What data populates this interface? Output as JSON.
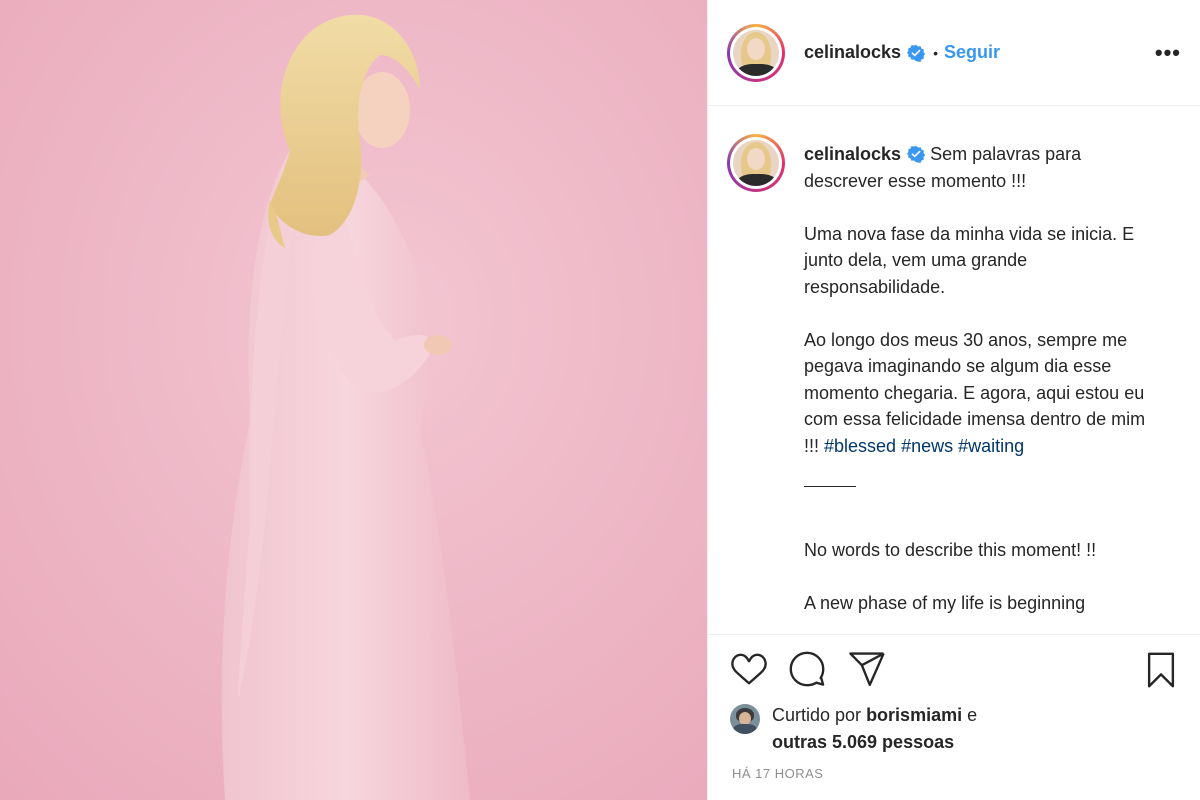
{
  "post": {
    "photo_alt": "photo",
    "background_color": "#efb9c8",
    "accent_color": "#3897f0",
    "hashtag_color": "#00376b"
  },
  "header": {
    "username": "celinalocks",
    "separator": "•",
    "follow_label": "Seguir",
    "more_label": "•••"
  },
  "caption": {
    "username": "celinalocks",
    "intro": "Sem palavras para descrever esse momento !!!",
    "paragraph_2": "Uma nova fase da minha vida se inicia. E junto dela, vem uma grande responsabilidade.",
    "paragraph_3_text": "Ao longo dos meus 30 anos, sempre me pegava imaginando se algum dia esse momento chegaria. E agora, aqui estou eu com essa felicidade imensa dentro de mim !!! ",
    "hashtags": [
      "#blessed",
      "#news",
      "#waiting"
    ],
    "english_1": "No words to describe this moment! !!",
    "english_2": "A new phase of my life is beginning"
  },
  "actions": {
    "icons": [
      "heart-icon",
      "comment-icon",
      "share-icon",
      "bookmark-icon"
    ]
  },
  "likes": {
    "prefix": "Curtido por",
    "liker": "borismiami",
    "conj": "e",
    "others": "outras 5.069 pessoas"
  },
  "timestamp": "HÁ 17 HORAS"
}
